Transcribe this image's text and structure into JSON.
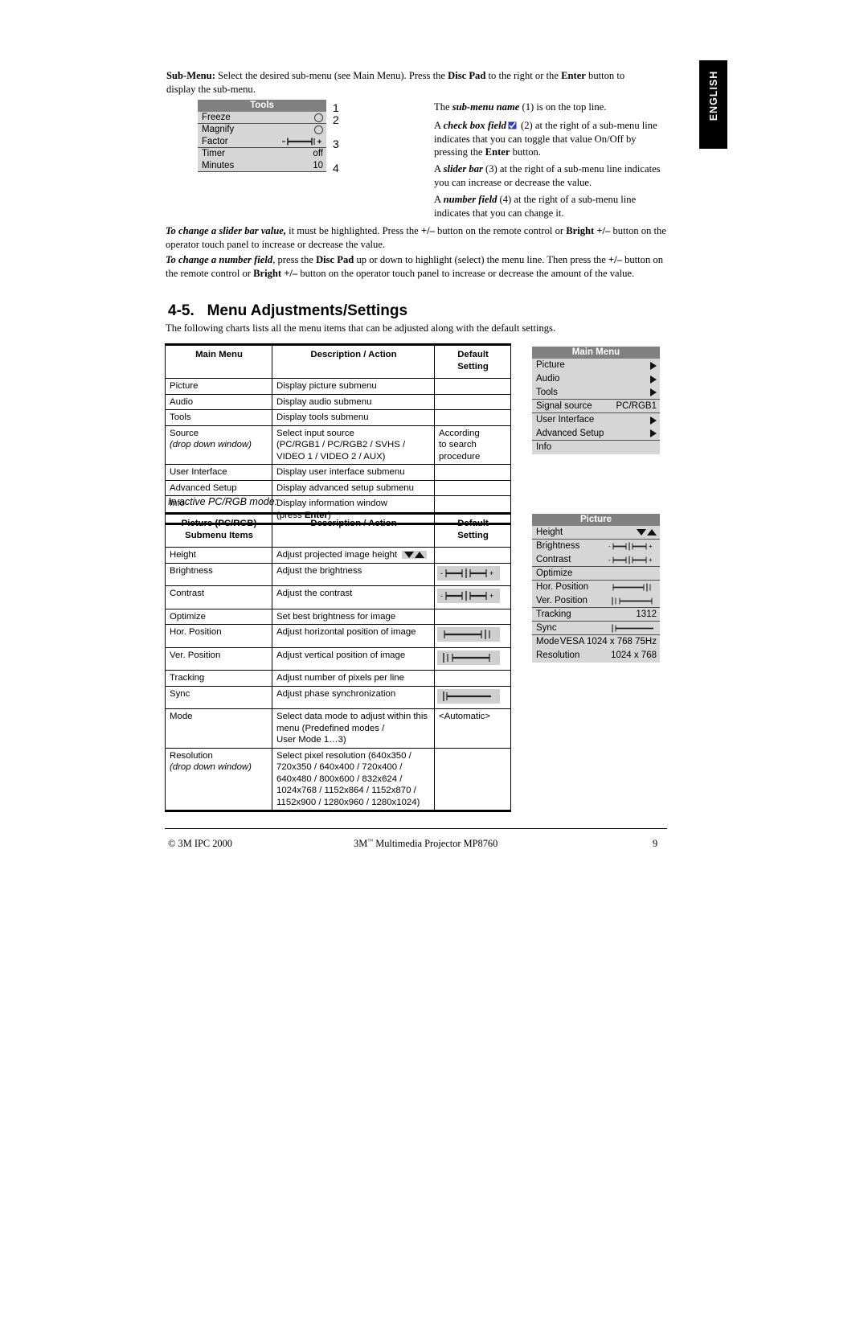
{
  "side_tab": {
    "label": "ENGLISH"
  },
  "intro": {
    "submenu_para": "Sub-Menu: Select the desired sub-menu (see Main Menu). Press the Disc Pad to the right or the Enter button to display the sub-menu."
  },
  "tools_osd": {
    "title": "Tools",
    "rows": [
      {
        "label": "Freeze",
        "value": "",
        "widget": "circle"
      },
      {
        "label": "Magnify",
        "value": "",
        "widget": "circle"
      },
      {
        "label": "Factor",
        "value": "",
        "widget": "slider"
      },
      {
        "label": "Timer",
        "value": "off",
        "widget": "text"
      },
      {
        "label": "Minutes",
        "value": "10",
        "widget": "text"
      }
    ],
    "callouts": [
      "1",
      "2",
      "3",
      "4"
    ]
  },
  "callout_notes": [
    "The sub-menu name (1) is on the top line.",
    "A check box field ☑ (2) at the right of a sub-menu line indicates that you can toggle that value On/Off by pressing the Enter button.",
    "A slider bar (3) at the right of a sub-menu line indicates you can increase or decrease the value.",
    "A number field (4) at the right of a sub-menu line indicates that you can change it."
  ],
  "paragraphs": {
    "slider_change": "To change a slider bar value, it must be highlighted.  Press the +/– button on the remote control or Bright +/– button on the operator touch panel to increase or decrease the value.",
    "number_change": "To change a number field, press the Disc Pad up or down to highlight (select) the menu line.  Then press the +/– button on the remote control or Bright +/– button on the operator touch panel to increase or decrease the amount of the value."
  },
  "section": {
    "number": "4-5.",
    "title": "Menu Adjustments/Settings",
    "lead_in": "The following charts lists all the menu items that can be adjusted along with the default settings."
  },
  "table_main": {
    "headers": [
      "Main Menu",
      "Description / Action",
      "Default Setting"
    ],
    "header_default_line1": "Default",
    "header_default_line2": "Setting",
    "rows": [
      {
        "item": "Picture",
        "item_sub": "",
        "desc": "Display picture submenu",
        "default": ""
      },
      {
        "item": "Audio",
        "item_sub": "",
        "desc": "Display audio submenu",
        "default": ""
      },
      {
        "item": "Tools",
        "item_sub": "",
        "desc": "Display tools submenu",
        "default": ""
      },
      {
        "item": "Source",
        "item_sub": "(drop down window)",
        "desc": "Select input source\n(PC/RGB1 / PC/RGB2 / SVHS /\nVIDEO 1 / VIDEO 2 / AUX)",
        "default": "According\nto search\nprocedure"
      },
      {
        "item": "User Interface",
        "item_sub": "",
        "desc": "Display user interface submenu",
        "default": ""
      },
      {
        "item": "Advanced Setup",
        "item_sub": "",
        "desc": "Display advanced setup submenu",
        "default": ""
      },
      {
        "item": "Info",
        "item_sub": "",
        "desc": "Display information window\n(press Enter)",
        "default": ""
      }
    ]
  },
  "mainmenu_osd": {
    "title": "Main Menu",
    "rows": [
      {
        "label": "Picture",
        "value": "",
        "widget": "arrow"
      },
      {
        "label": "Audio",
        "value": "",
        "widget": "arrow"
      },
      {
        "label": "Tools",
        "value": "",
        "widget": "arrow"
      },
      {
        "label": "Signal source",
        "value": "PC/RGB1",
        "widget": "text"
      },
      {
        "label": "User Interface",
        "value": "",
        "widget": "arrow"
      },
      {
        "label": "Advanced Setup",
        "value": "",
        "widget": "arrow"
      },
      {
        "label": "Info",
        "value": "",
        "widget": "none"
      }
    ]
  },
  "pcrgb_note": "In active PC/RGB mode:",
  "table_picture": {
    "header_col1_line1": "Picture (PC/RGB)",
    "header_col1_line2": "Submenu Items",
    "header_col2": "Description / Action",
    "header_col3_line1": "Default",
    "header_col3_line2": "Setting",
    "rows": [
      {
        "item": "Height",
        "item_sub": "",
        "desc": "Adjust projected image height",
        "desc_widget": "updown",
        "default": "",
        "default_widget": "none"
      },
      {
        "item": "Brightness",
        "item_sub": "",
        "desc": "Adjust the brightness",
        "desc_widget": "none",
        "default": "",
        "default_widget": "slider-mid"
      },
      {
        "item": "Contrast",
        "item_sub": "",
        "desc": "Adjust the contrast",
        "desc_widget": "none",
        "default": "",
        "default_widget": "slider-mid"
      },
      {
        "item": "Optimize",
        "item_sub": "",
        "desc": "Set best brightness for image",
        "desc_widget": "none",
        "default": "",
        "default_widget": "none"
      },
      {
        "item": "Hor. Position",
        "item_sub": "",
        "desc": "Adjust horizontal position of image",
        "desc_widget": "none",
        "default": "",
        "default_widget": "slider-right"
      },
      {
        "item": "Ver. Position",
        "item_sub": "",
        "desc": "Adjust vertical position of image",
        "desc_widget": "none",
        "default": "",
        "default_widget": "slider-left"
      },
      {
        "item": "Tracking",
        "item_sub": "",
        "desc": "Adjust number of pixels per line",
        "desc_widget": "none",
        "default": "",
        "default_widget": "none"
      },
      {
        "item": "Sync",
        "item_sub": "",
        "desc": "Adjust phase synchronization",
        "desc_widget": "none",
        "default": "",
        "default_widget": "slider-start"
      },
      {
        "item": "Mode",
        "item_sub": "",
        "desc": "Select data mode to adjust within this\nmenu (Predefined modes /\nUser Mode 1…3)",
        "desc_widget": "none",
        "default": "<Automatic>",
        "default_widget": "none"
      },
      {
        "item": "Resolution",
        "item_sub": "(drop down window)",
        "desc": "Select pixel resolution (640x350 /\n720x350 / 640x400 / 720x400 /\n640x480 / 800x600 / 832x624 /\n1024x768 / 1152x864 / 1152x870 /\n1152x900 / 1280x960 / 1280x1024)",
        "desc_widget": "none",
        "default": "",
        "default_widget": "none"
      }
    ]
  },
  "picture_osd": {
    "title": "Picture",
    "rows": [
      {
        "label": "Height",
        "value": "",
        "widget": "updown"
      },
      {
        "label": "Brightness",
        "value": "",
        "widget": "slider-mid"
      },
      {
        "label": "Contrast",
        "value": "",
        "widget": "slider-mid"
      },
      {
        "label": "Optimize",
        "value": "",
        "widget": "none"
      },
      {
        "label": "Hor. Position",
        "value": "",
        "widget": "slider-right"
      },
      {
        "label": "Ver. Position",
        "value": "",
        "widget": "slider-left"
      },
      {
        "label": "Tracking",
        "value": "1312",
        "widget": "text"
      },
      {
        "label": "Sync",
        "value": "",
        "widget": "slider-start"
      },
      {
        "label": "Mode",
        "value": "VESA 1024 x 768 75Hz",
        "widget": "text"
      },
      {
        "label": "Resolution",
        "value": "1024 x 768",
        "widget": "text"
      }
    ]
  },
  "footer": {
    "left": "© 3M IPC 2000",
    "center_prefix": "3M",
    "center_sup": "™",
    "center_rest": " Multimedia Projector MP8760",
    "page_number": "9"
  },
  "colors": {
    "osd_bg": "#d6d6d6",
    "osd_title_bg": "#808080",
    "swatch_bg": "#cfcfcf",
    "text": "#000000"
  }
}
